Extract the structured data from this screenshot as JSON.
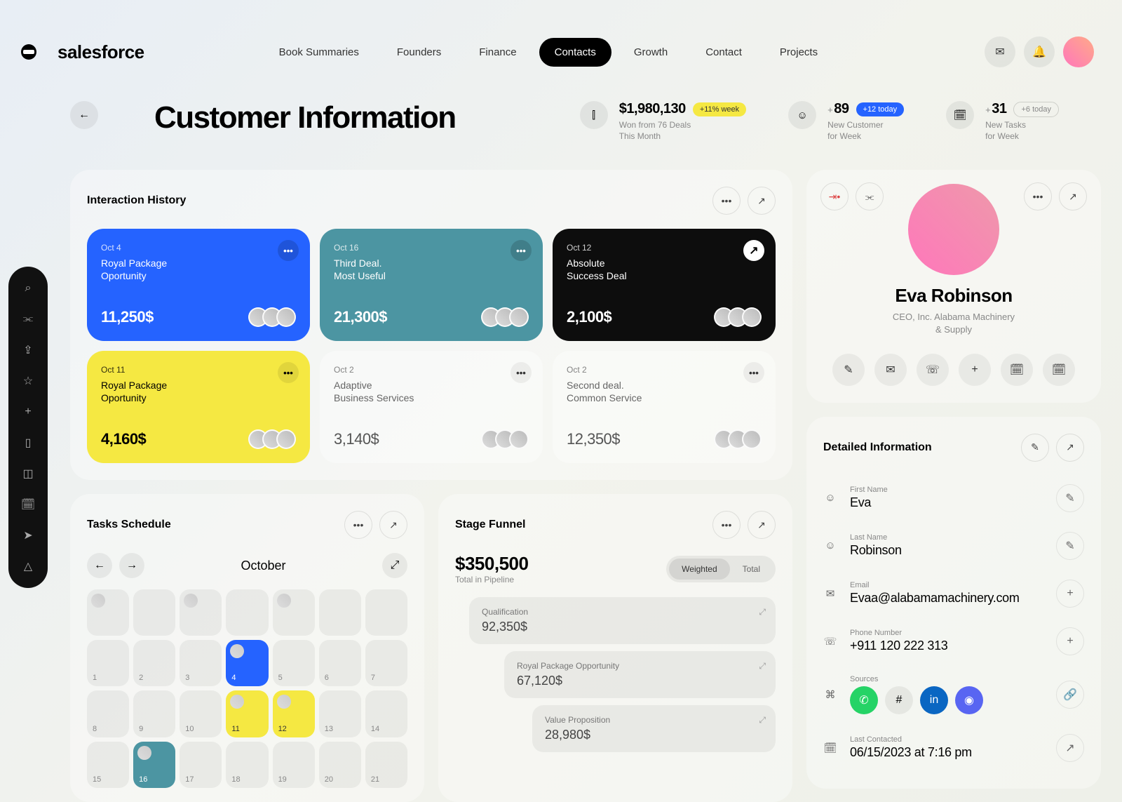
{
  "brand": "salesforce",
  "nav": [
    "Book Summaries",
    "Founders",
    "Finance",
    "Contacts",
    "Growth",
    "Contact",
    "Projects"
  ],
  "nav_active": 3,
  "page_title": "Customer Information",
  "stats": [
    {
      "icon": "⫿",
      "value": "$1,980,130",
      "badge": "+11% week",
      "badge_cls": "b-yellow",
      "sub": "Won from 76 Deals\nThis Month"
    },
    {
      "icon": "☺",
      "pre": "+",
      "value": "89",
      "badge": "+12 today",
      "badge_cls": "b-blue",
      "sub": "New Customer\nfor Week"
    },
    {
      "icon": "🗓",
      "pre": "+",
      "value": "31",
      "badge": "+6 today",
      "badge_cls": "b-outline",
      "sub": "New Tasks\nfor Week"
    }
  ],
  "history": {
    "title": "Interaction History",
    "cards": [
      {
        "cls": "blue",
        "date": "Oct 4",
        "title": "Royal Package\nOportunity",
        "amount": "11,250$",
        "menu": "•••"
      },
      {
        "cls": "teal",
        "date": "Oct 16",
        "title": "Third Deal.\nMost Useful",
        "amount": "21,300$",
        "menu": "•••"
      },
      {
        "cls": "black",
        "date": "Oct 12",
        "title": "Absolute\nSuccess Deal",
        "amount": "2,100$",
        "menu": "↗"
      },
      {
        "cls": "yellow",
        "date": "Oct 11",
        "title": "Royal Package\nOportunity",
        "amount": "4,160$",
        "menu": "•••"
      },
      {
        "cls": "plain",
        "date": "Oct 2",
        "title": "Adaptive\nBusiness Services",
        "amount": "3,140$",
        "menu": "•••"
      },
      {
        "cls": "plain",
        "date": "Oct 2",
        "title": "Second deal.\nCommon Service",
        "amount": "12,350$",
        "menu": "•••"
      }
    ]
  },
  "schedule": {
    "title": "Tasks Schedule",
    "month": "October",
    "cells": [
      {
        "n": "",
        "dot": true
      },
      {
        "n": ""
      },
      {
        "n": "",
        "dot": true
      },
      {
        "n": ""
      },
      {
        "n": "",
        "dot": true
      },
      {
        "n": ""
      },
      {
        "n": ""
      },
      {
        "n": "1"
      },
      {
        "n": "2"
      },
      {
        "n": "3"
      },
      {
        "n": "4",
        "cls": "blue",
        "dot": true
      },
      {
        "n": "5"
      },
      {
        "n": "6"
      },
      {
        "n": "7"
      },
      {
        "n": "8"
      },
      {
        "n": "9"
      },
      {
        "n": "10"
      },
      {
        "n": "11",
        "cls": "yellow",
        "dot": true
      },
      {
        "n": "12",
        "cls": "yellow",
        "dot": true
      },
      {
        "n": "13"
      },
      {
        "n": "14"
      },
      {
        "n": "15"
      },
      {
        "n": "16",
        "cls": "teal",
        "dot": true
      },
      {
        "n": "17"
      },
      {
        "n": "18"
      },
      {
        "n": "19"
      },
      {
        "n": "20"
      },
      {
        "n": "21"
      }
    ]
  },
  "funnel": {
    "title": "Stage Funnel",
    "total": "$350,500",
    "sub": "Total in Pipeline",
    "toggles": [
      "Weighted",
      "Total"
    ],
    "toggle_active": 0,
    "items": [
      {
        "label": "Qualification",
        "amount": "92,350$"
      },
      {
        "label": "Royal Package Opportunity",
        "amount": "67,120$"
      },
      {
        "label": "Value Proposition",
        "amount": "28,980$"
      }
    ]
  },
  "profile": {
    "name": "Eva Robinson",
    "role": "CEO, Inc. Alabama Machinery\n& Supply"
  },
  "details": {
    "title": "Detailed Information",
    "rows": [
      {
        "icon": "☺",
        "label": "First Name",
        "value": "Eva",
        "action": "✎"
      },
      {
        "icon": "☺",
        "label": "Last Name",
        "value": "Robinson",
        "action": "✎"
      },
      {
        "icon": "✉",
        "label": "Email",
        "value": "Evaa@alabamamachinery.com",
        "action": "+"
      },
      {
        "icon": "☏",
        "label": "Phone Number",
        "value": "+911 120 222 313",
        "action": "+"
      },
      {
        "icon": "⌘",
        "label": "Sources",
        "value": "",
        "action": "🔗",
        "sources": true
      },
      {
        "icon": "🗓",
        "label": "Last Contacted",
        "value": "06/15/2023 at 7:16 pm",
        "action": "↗"
      }
    ]
  }
}
